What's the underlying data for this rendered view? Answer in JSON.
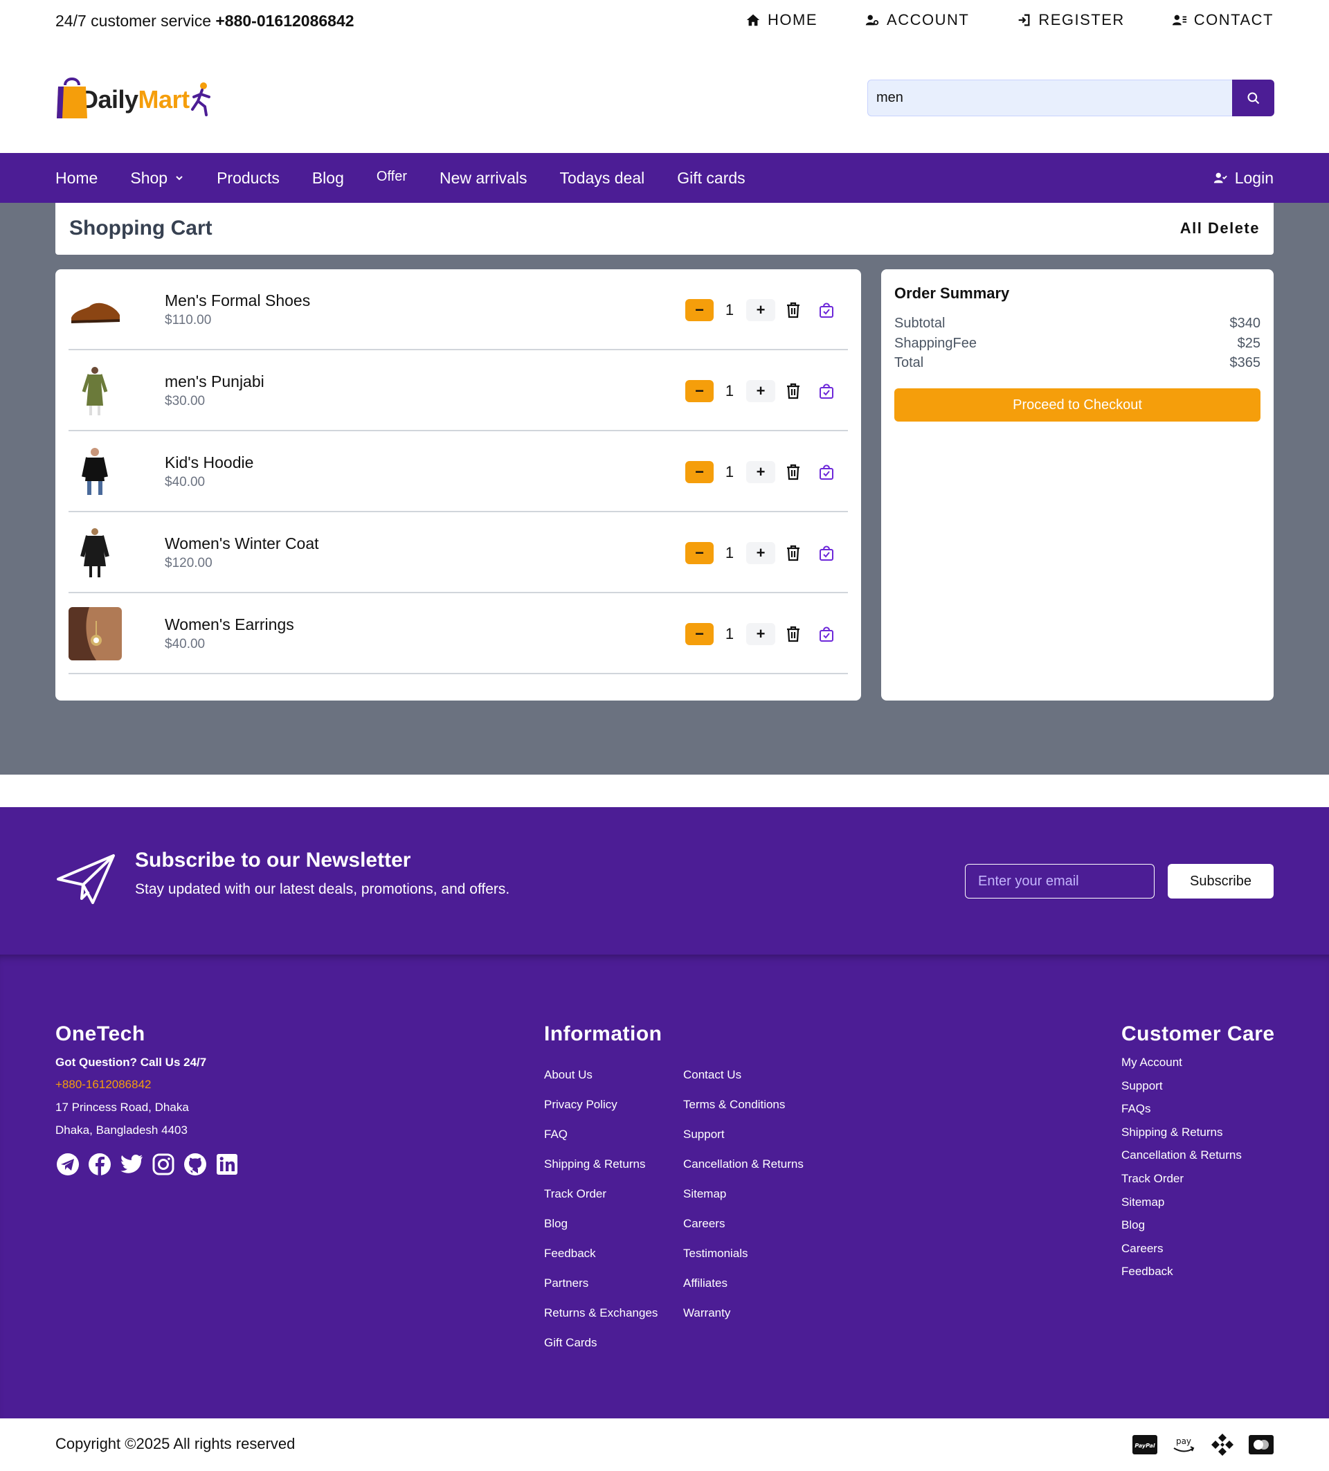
{
  "topbar": {
    "service_prefix": "24/7 customer service",
    "service_phone": "+880-01612086842",
    "links": [
      {
        "label": "HOME",
        "icon": "home-icon"
      },
      {
        "label": "ACCOUNT",
        "icon": "user-cog-icon"
      },
      {
        "label": "REGISTER",
        "icon": "sign-in-icon"
      },
      {
        "label": "CONTACT",
        "icon": "contact-icon"
      }
    ]
  },
  "header": {
    "logo_text_a": "Daily",
    "logo_text_b": "Mart",
    "search_value": "men",
    "search_icon": "search-icon"
  },
  "nav": {
    "items": [
      "Home",
      "Shop",
      "Products",
      "Blog",
      "Offer",
      "New arrivals",
      "Todays deal",
      "Gift cards"
    ],
    "login": "Login"
  },
  "cart": {
    "title": "Shopping Cart",
    "all_delete": "All Delete",
    "items": [
      {
        "name": "Men's Formal Shoes",
        "price": "$110.00",
        "qty": "1"
      },
      {
        "name": "men's Punjabi",
        "price": "$30.00",
        "qty": "1"
      },
      {
        "name": "Kid's Hoodie",
        "price": "$40.00",
        "qty": "1"
      },
      {
        "name": "Women's Winter Coat",
        "price": "$120.00",
        "qty": "1"
      },
      {
        "name": "Women's Earrings",
        "price": "$40.00",
        "qty": "1"
      }
    ],
    "minus": "−",
    "plus": "+"
  },
  "summary": {
    "title": "Order Summary",
    "subtotal_label": "Subtotal",
    "subtotal": "$340",
    "fee_label": "ShappingFee",
    "fee": "$25",
    "total_label": "Total",
    "total": "$365",
    "checkout": "Proceed to Checkout"
  },
  "newsletter": {
    "title": "Subscribe to our Newsletter",
    "subtitle": "Stay updated with our latest deals, promotions, and offers.",
    "placeholder": "Enter your email",
    "button": "Subscribe"
  },
  "footer": {
    "brand": {
      "title": "OneTech",
      "question": "Got Question? Call Us 24/7",
      "phone": "+880-1612086842",
      "address1": "17 Princess Road, Dhaka",
      "address2": "Dhaka, Bangladesh 4403"
    },
    "information": {
      "title": "Information",
      "col1": [
        "About Us",
        "Privacy Policy",
        "FAQ",
        "Shipping & Returns",
        "Track Order",
        "Blog",
        "Feedback",
        "Partners",
        "Returns & Exchanges",
        "Gift Cards"
      ],
      "col2": [
        "Contact Us",
        "Terms & Conditions",
        "Support",
        "Cancellation & Returns",
        "Sitemap",
        "Careers",
        "Testimonials",
        "Affiliates",
        "Warranty"
      ]
    },
    "care": {
      "title": "Customer Care",
      "links": [
        "My Account",
        "Support",
        "FAQs",
        "Shipping & Returns",
        "Cancellation & Returns",
        "Track Order",
        "Sitemap",
        "Blog",
        "Careers",
        "Feedback"
      ]
    },
    "copyright": "Copyright ©2025 All rights reserved",
    "pay_icons": [
      "paypal-icon",
      "amazon-pay-icon",
      "binance-icon",
      "mastercard-icon"
    ],
    "pay_labels": {
      "paypal": "PayPal",
      "amazon": "pay"
    }
  },
  "colors": {
    "brand_purple": "#4c1d95",
    "accent_orange": "#f59e0b",
    "gray_bg": "#6b7280"
  }
}
